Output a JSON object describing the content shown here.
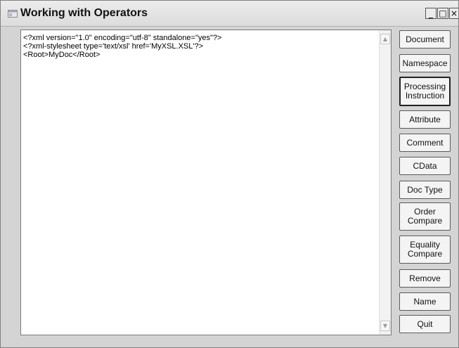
{
  "window": {
    "title": "Working with Operators",
    "controls": {
      "minimize": "_",
      "maximize": "□",
      "close": "×"
    }
  },
  "editor": {
    "lines": [
      "<?xml version=\"1.0\" encoding=\"utf-8\" standalone=\"yes\"?>",
      "<?xml-stylesheet type='text/xsl' href='MyXSL.XSL'?>",
      "<Root>MyDoc</Root>"
    ],
    "scroll_up": "▲",
    "scroll_down": "▼"
  },
  "buttons": {
    "document": "Document",
    "namespace": "Namespace",
    "processing_instruction": "Processing\nInstruction",
    "attribute": "Attribute",
    "comment": "Comment",
    "cdata": "CData",
    "doc_type": "Doc Type",
    "order_compare": "Order\nCompare",
    "equality_compare": "Equality\nCompare",
    "remove": "Remove",
    "name": "Name",
    "quit": "Quit"
  }
}
